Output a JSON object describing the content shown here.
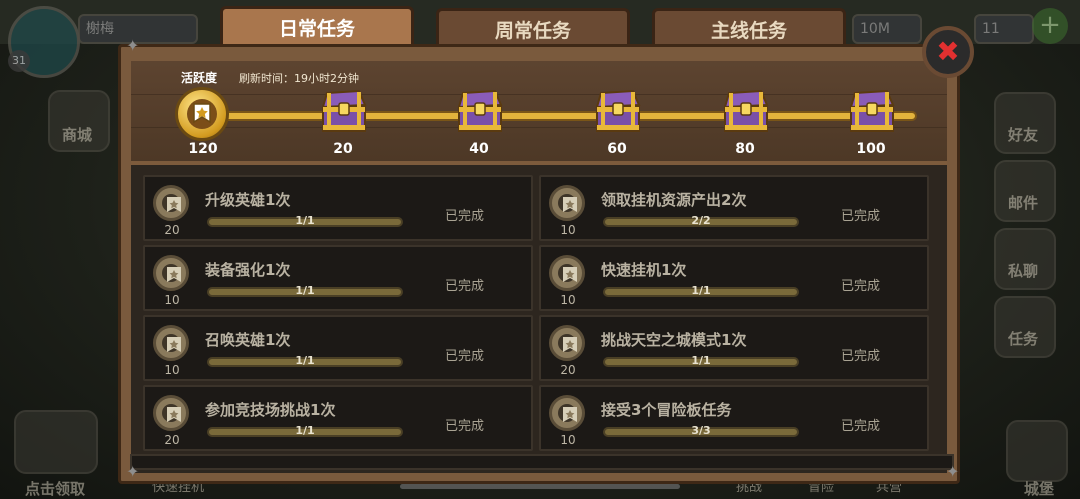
{
  "background": {
    "player_name_placeholder": "榭梅",
    "player_level": "31",
    "resource_10m": "10M",
    "resource_11": "11",
    "left_menu": {
      "shop_label": "商城",
      "claim_label": "点击领取",
      "auto_battle_label": "快速挂机"
    },
    "right_menu": {
      "friends_label": "好友",
      "mail_label": "邮件",
      "chat_label": "私聊",
      "tasks_label": "任务",
      "castle_label": "城堡"
    },
    "bottom_nav": {
      "battle_label": "挑战",
      "adventure_label": "冒险",
      "camp_label": "兵营"
    }
  },
  "tabs": [
    {
      "label": "日常任务",
      "active": true
    },
    {
      "label": "周常任务",
      "active": false
    },
    {
      "label": "主线任务",
      "active": false
    }
  ],
  "activity": {
    "label": "活跃度",
    "refresh_text": "刷新时间：19小时2分钟",
    "current_points": "120",
    "milestones": [
      "20",
      "40",
      "60",
      "80",
      "100"
    ]
  },
  "tasks": [
    {
      "name": "升级英雄1次",
      "points": "20",
      "progress": "1/1",
      "status": "已完成"
    },
    {
      "name": "领取挂机资源产出2次",
      "points": "10",
      "progress": "2/2",
      "status": "已完成"
    },
    {
      "name": "装备强化1次",
      "points": "10",
      "progress": "1/1",
      "status": "已完成"
    },
    {
      "name": "快速挂机1次",
      "points": "10",
      "progress": "1/1",
      "status": "已完成"
    },
    {
      "name": "召唤英雄1次",
      "points": "10",
      "progress": "1/1",
      "status": "已完成"
    },
    {
      "name": "挑战天空之城模式1次",
      "points": "20",
      "progress": "1/1",
      "status": "已完成"
    },
    {
      "name": "参加竞技场挑战1次",
      "points": "20",
      "progress": "1/1",
      "status": "已完成"
    },
    {
      "name": "接受3个冒险板任务",
      "points": "10",
      "progress": "3/3",
      "status": "已完成"
    }
  ],
  "colors": {
    "accent": "#e3b33c",
    "tab_active": "#a9764d",
    "close_x": "#e23030"
  }
}
